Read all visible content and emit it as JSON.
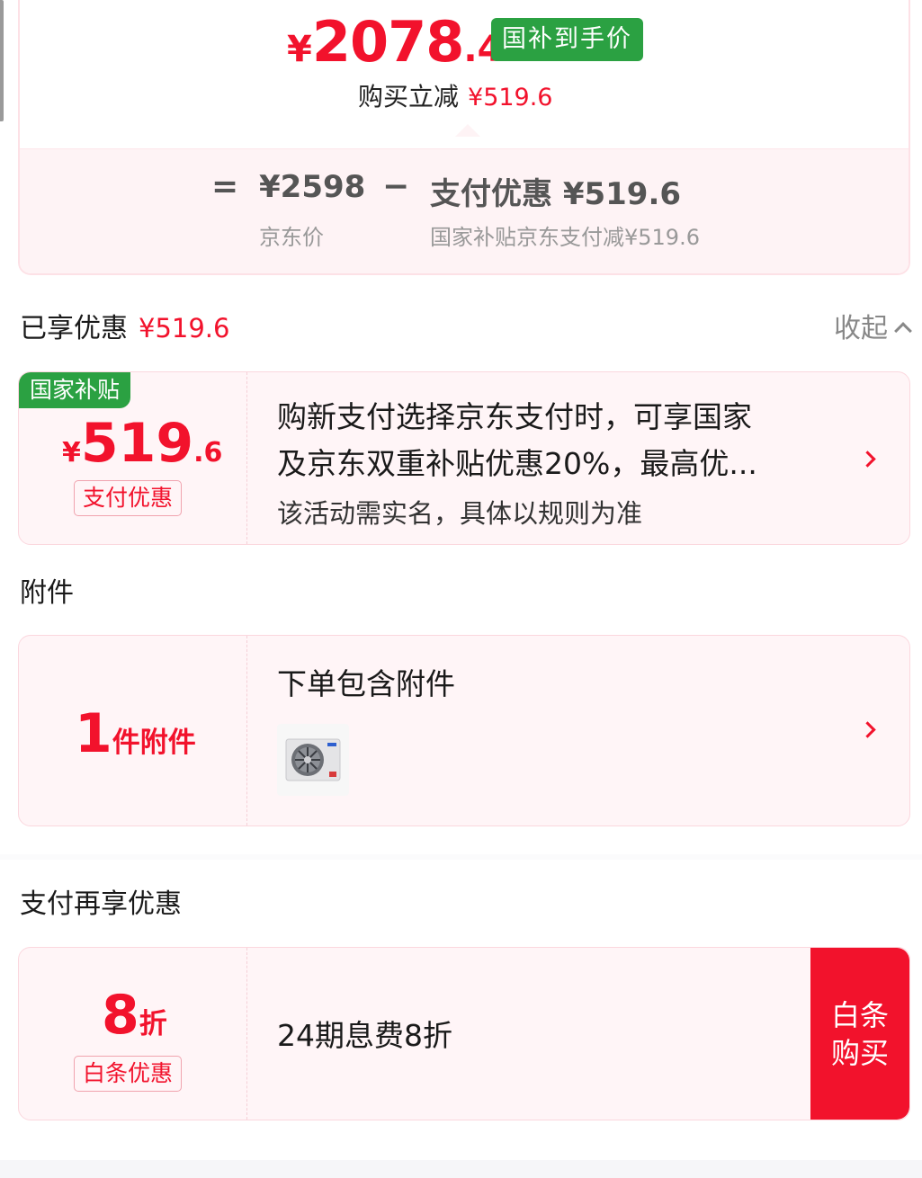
{
  "price_card": {
    "currency": "¥",
    "final_int": "2078",
    "final_dec": ".4",
    "final_tag": "国补到手价",
    "reduce_label": "购买立减",
    "reduce_value": "¥519.6",
    "eq_sign": "=",
    "minus_sign": "−",
    "jd_price_value": "¥2598",
    "jd_price_label": "京东价",
    "pay_discount_value": "支付优惠 ¥519.6",
    "pay_discount_label": "国家补贴京东支付减¥519.6"
  },
  "enjoyed": {
    "title": "已享优惠",
    "value": "¥519.6",
    "collapse_label": "收起"
  },
  "subsidy_card": {
    "tag": "国家补贴",
    "currency": "¥",
    "amount_int": "519",
    "amount_dec": ".6",
    "badge": "支付优惠",
    "desc_line1": "购新支付选择京东支付时，可享国家",
    "desc_line2": "及京东双重补贴优惠20%，最高优...",
    "note": "该活动需实名，具体以规则为准"
  },
  "accessory": {
    "section_title": "附件",
    "count": "1",
    "count_unit": "件附件",
    "title": "下单包含附件"
  },
  "pay_more": {
    "section_title": "支付再享优惠",
    "discount_num": "8",
    "discount_unit": "折",
    "badge": "白条优惠",
    "desc": "24期息费8折",
    "button_line1": "白条",
    "button_line2": "购买"
  },
  "colors": {
    "accent_red": "#f2122c",
    "green": "#2ba142",
    "card_bg": "#fff5f7"
  }
}
